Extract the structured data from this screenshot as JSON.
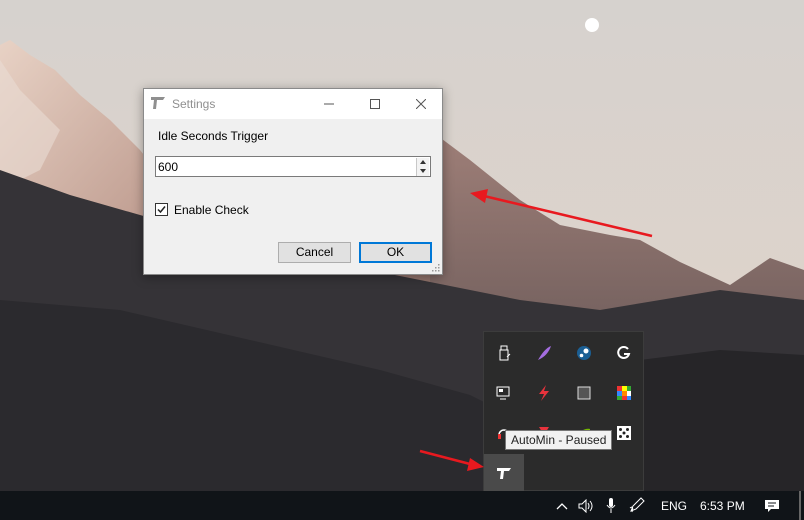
{
  "dialog": {
    "title": "Settings",
    "icon": "automin-funnel-icon",
    "idle_label": "Idle Seconds Trigger",
    "idle_value": "600",
    "enable_check_label": "Enable Check",
    "enable_check_checked": true,
    "cancel_label": "Cancel",
    "ok_label": "OK"
  },
  "tray_flyout": {
    "icons": [
      "usb-drive-icon",
      "feather-icon",
      "steam-icon",
      "logitech-g-icon",
      "remote-display-icon",
      "lightning-icon",
      "square-app-icon",
      "rubiks-cube-icon",
      "headset-icon",
      "red-arrow-icon",
      "nvidia-icon",
      "dice-icon",
      "automin-tray-icon"
    ],
    "tooltip": "AutoMin - Paused"
  },
  "taskbar": {
    "language": "ENG",
    "time": "6:53 PM"
  },
  "colors": {
    "accent": "#0078d7",
    "annotation_arrow": "#e8191f",
    "taskbar": "#101418"
  }
}
